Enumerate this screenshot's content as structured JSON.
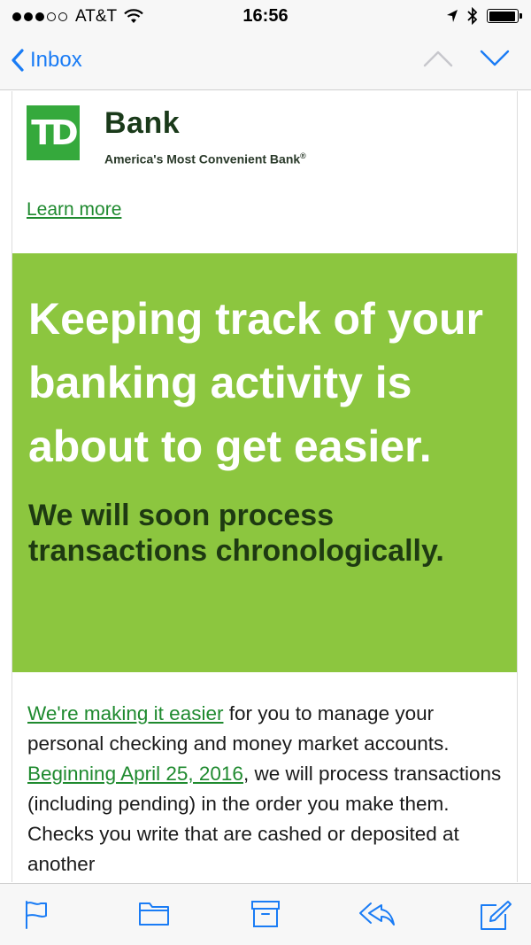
{
  "status_bar": {
    "carrier": "AT&T",
    "time": "16:56",
    "signal_bars_filled": 3,
    "signal_bars_total": 5,
    "battery_level": 0.95
  },
  "nav": {
    "back_label": "Inbox",
    "accent_color": "#1a7cf5"
  },
  "email": {
    "logo_mark": "TD",
    "bank_name": "Bank",
    "tagline": "America's Most Convenient Bank",
    "tagline_mark": "®",
    "learn_more": "Learn more",
    "hero_title": "Keeping track of your banking activity is about to get easier.",
    "hero_subtitle": "We will soon process transactions chronologically.",
    "hero_bg_color": "#8cc63f",
    "brand_green": "#35a93c",
    "body_link_1": "We're making it easier",
    "body_text_1": " for you to manage your personal checking and money market accounts. ",
    "body_link_2": "Beginning April 25, 2016",
    "body_text_2": ", we will process transactions (including pending) in the order you make them. Checks you write that are cashed or deposited at another"
  },
  "toolbar": {
    "icons": [
      "flag-icon",
      "folder-icon",
      "archive-icon",
      "reply-icon",
      "compose-icon"
    ]
  }
}
